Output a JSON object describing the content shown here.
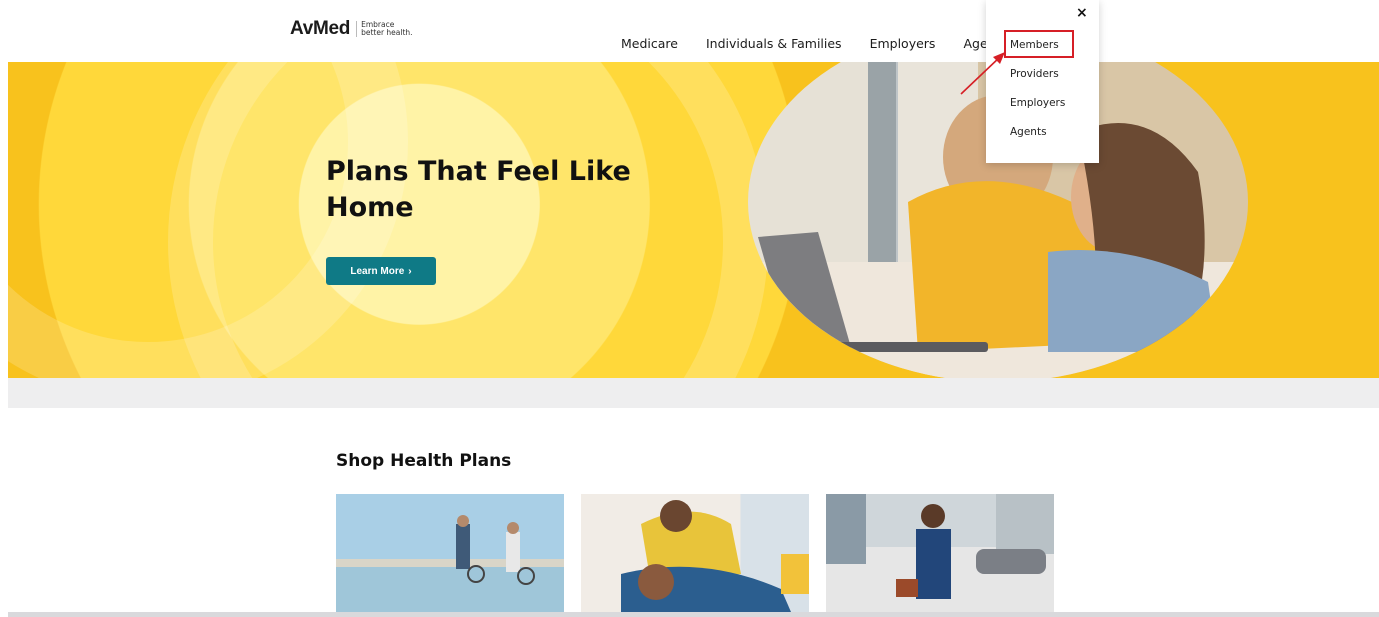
{
  "header": {
    "logo_word": "AvMed",
    "logo_tagline": "Embrace better health.",
    "nav": [
      "Medicare",
      "Individuals & Families",
      "Employers",
      "Age"
    ]
  },
  "hero": {
    "title": "Plans That Feel Like Home",
    "cta_label": "Learn More",
    "cta_chevron": "›"
  },
  "dropdown": {
    "close_label": "×",
    "items": [
      "Members",
      "Providers",
      "Employers",
      "Agents"
    ],
    "highlighted_item": "Members"
  },
  "shop": {
    "title": "Shop Health Plans",
    "cards": [
      {
        "icon": "couple-beach-bikes-photo"
      },
      {
        "icon": "family-playing-photo"
      },
      {
        "icon": "businessman-street-photo"
      }
    ]
  },
  "colors": {
    "cta_teal": "#0f7a86",
    "highlight_red": "#d61f26",
    "hero_yellow": "#f8c21d"
  }
}
